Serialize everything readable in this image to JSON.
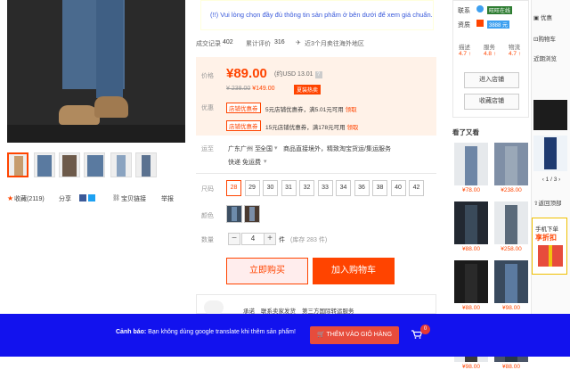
{
  "notice": {
    "text": "(!!) Vui lòng chọn đầy đủ thông tin sản phẩm ở bên dưới để xem giá chuẩn."
  },
  "stats": {
    "deals_label": "成交记录",
    "deals_value": "402",
    "reviews_label": "累计评价",
    "reviews_value": "316",
    "overseas": "近3个月卖往海外地区"
  },
  "price": {
    "label": "价格",
    "value": "¥89.00",
    "usd": "(约USD 13.01",
    "qmark": "?",
    "old": "¥ 238.00",
    "old_suffix": "¥149.00",
    "promo_badge": "夏装热卖",
    "discount_label": "优惠",
    "coupon1_tag": "店铺优惠券",
    "coupon1_text": "5元店铺优惠券，满5.01元可用",
    "coupon1_link": "领取",
    "coupon2_tag": "店铺优惠券",
    "coupon2_text": "15元店铺优惠券，满178元可用",
    "coupon2_link": "领取"
  },
  "shipping": {
    "label": "运至",
    "from": "广东广州 至",
    "to": "全国",
    "note": "商品直接境外，精致淘宝货运/集运服务",
    "express": "快递 免运费"
  },
  "sizes": {
    "label": "尺码",
    "options": [
      "28",
      "29",
      "30",
      "31",
      "32",
      "33",
      "34",
      "36",
      "38",
      "40",
      "42"
    ],
    "selected": "28"
  },
  "colors": {
    "label": "颜色"
  },
  "quantity": {
    "label": "数量",
    "value": "4",
    "unit": "件",
    "stock": "(库存 283 件)",
    "minus": "−",
    "plus": "+"
  },
  "actions": {
    "buy_now": "立即购买",
    "add_to_cart": "加入购物车"
  },
  "service": {
    "label": "承诺",
    "item1": "联系卖家发货",
    "item2": "第三方国际转运服务"
  },
  "share": {
    "favorite": "收藏(2119)",
    "share_label": "分享",
    "report_label": "举报",
    "compare": "宝贝链接"
  },
  "shop": {
    "contact_label": "联系",
    "badge1": "旺旺在线",
    "name_label": "资质",
    "badge2": "3888 元",
    "rating_labels": [
      "描述",
      "服务",
      "物流"
    ],
    "rating_values": [
      "4.7 ↑",
      "4.8 ↑",
      "4.7 ↑"
    ],
    "enter_shop": "进入店铺",
    "favorite_shop": "收藏店铺"
  },
  "recommend": {
    "title": "看了又看",
    "prices": [
      "¥78.00",
      "¥238.00",
      "¥88.00",
      "¥258.00",
      "¥88.00",
      "¥98.00",
      "¥98.00",
      "¥88.00"
    ]
  },
  "toolbar": {
    "discount": "优惠",
    "cart": "购物车",
    "recent": "近期浏览",
    "pager": "1 / 3",
    "back_top": "返回顶部",
    "ad_line1": "手机下单",
    "ad_line2": "享折扣"
  },
  "bottom": {
    "warning_bold": "Cảnh báo:",
    "warning_text": " Bạn không dùng google translate khi thêm sản phẩm!",
    "cart_button": "THÊM VÀO GIỎ HÀNG",
    "cart_count": "0"
  }
}
